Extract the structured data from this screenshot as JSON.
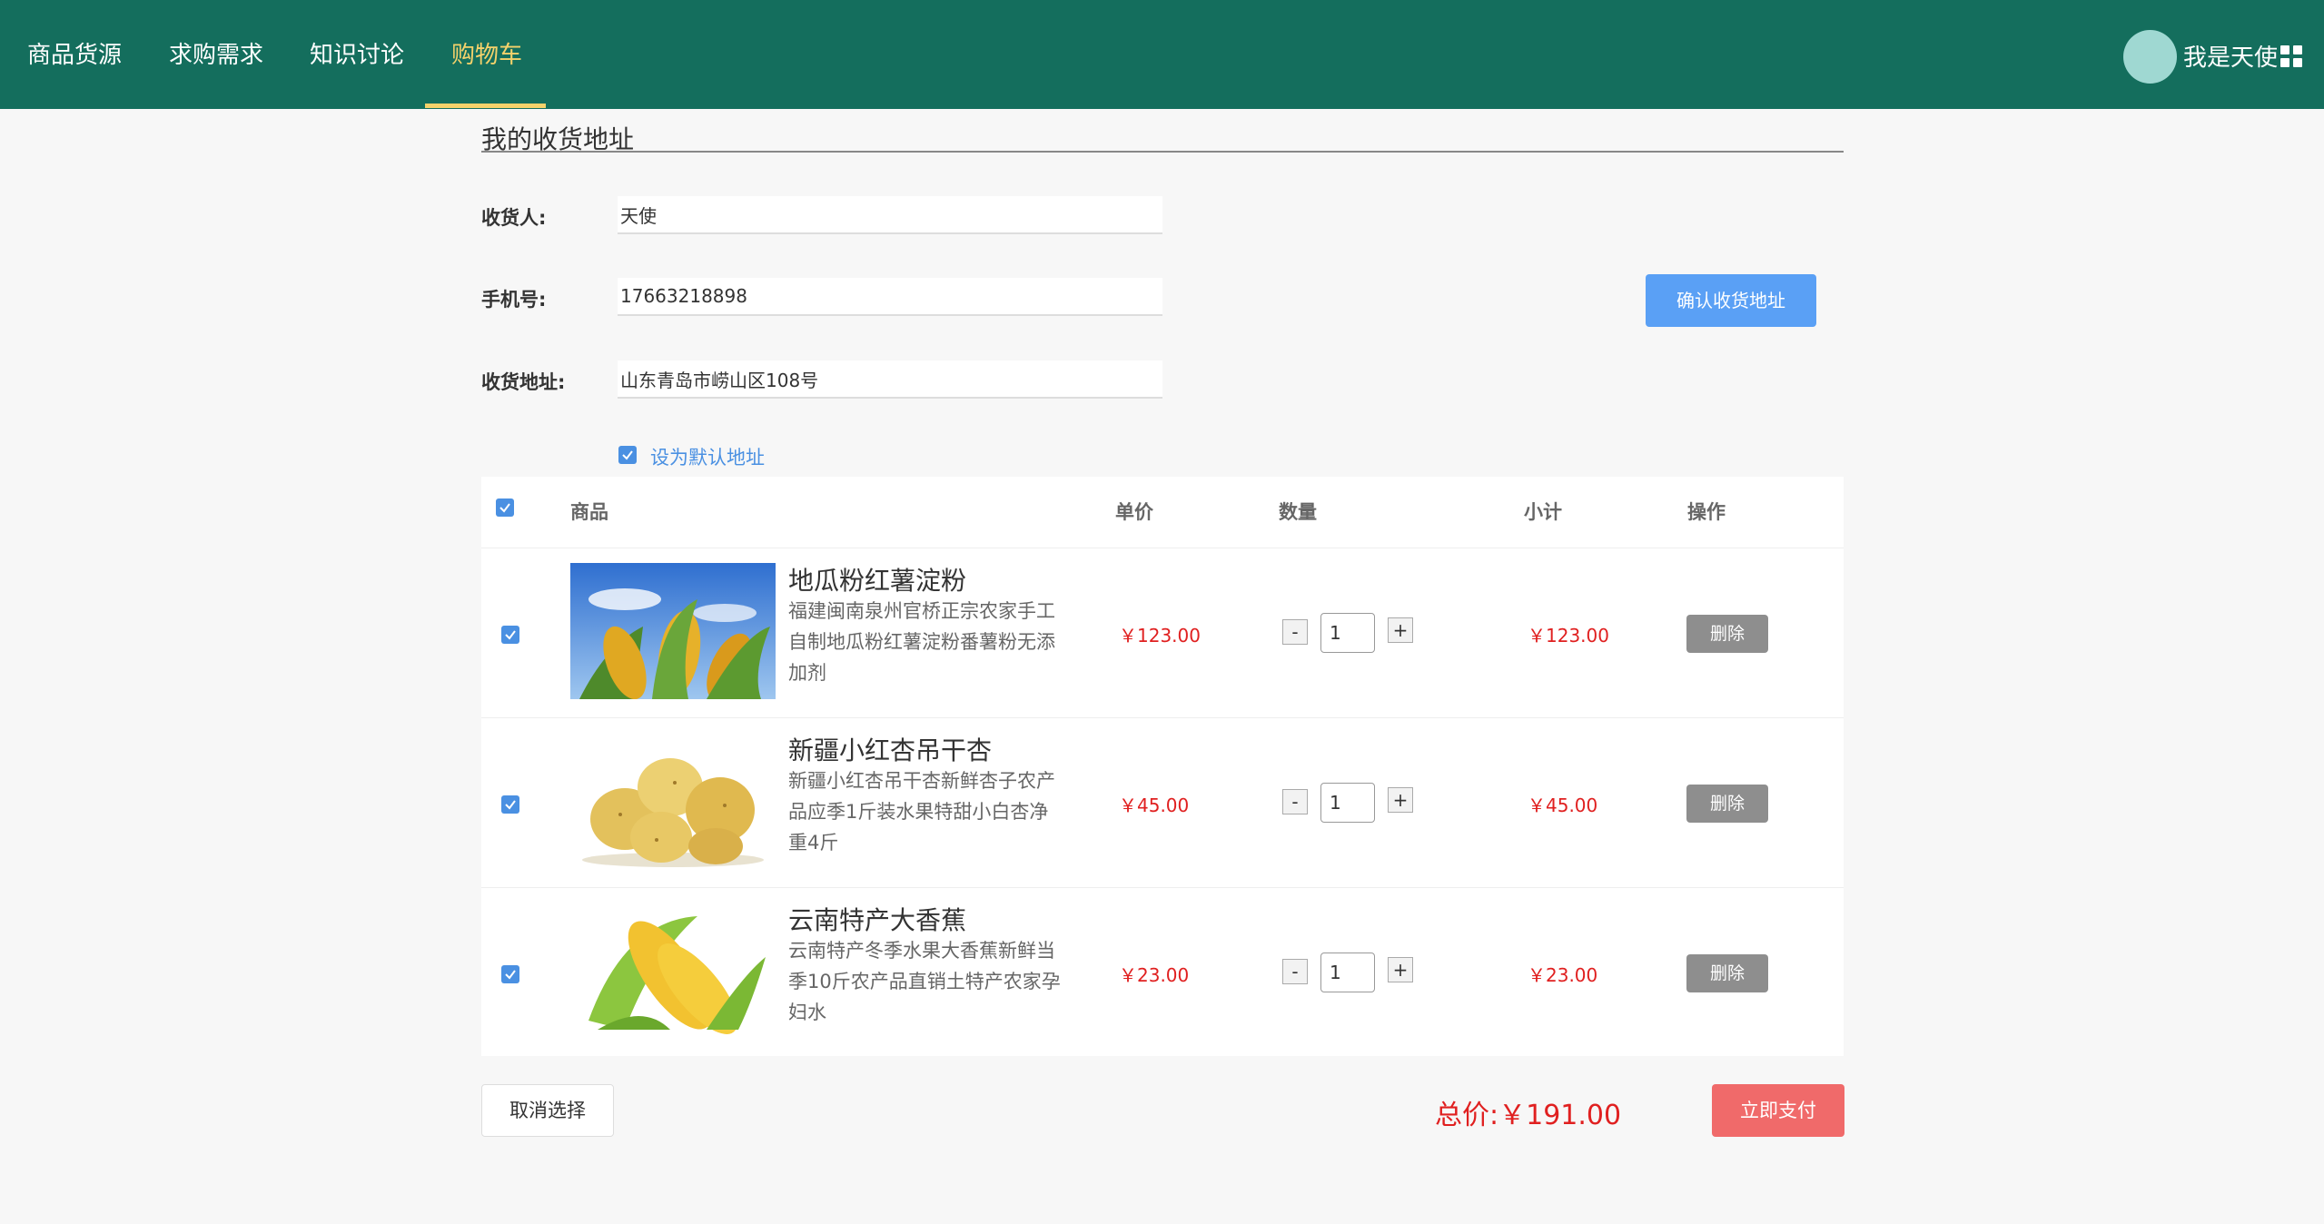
{
  "nav": {
    "items": [
      {
        "label": "商品货源",
        "active": false
      },
      {
        "label": "求购需求",
        "active": false
      },
      {
        "label": "知识讨论",
        "active": false
      },
      {
        "label": "购物车",
        "active": true
      }
    ],
    "username": "我是天使",
    "avatar_icon": "avatar",
    "menu_icon": "grid-icon",
    "colors": {
      "background": "#146e5d",
      "active": "#f5d26b"
    }
  },
  "address": {
    "title": "我的收货地址",
    "receiver_label": "收货人:",
    "receiver_value": "天使",
    "phone_label": "手机号:",
    "phone_value": "17663218898",
    "address_label": "收货地址:",
    "address_value": "山东青岛市崂山区108号",
    "default_label": "设为默认地址",
    "default_checked": true,
    "confirm_label": "确认收货地址"
  },
  "cart": {
    "headers": {
      "product": "商品",
      "unit_price": "单价",
      "quantity": "数量",
      "subtotal": "小计",
      "action": "操作"
    },
    "select_all_checked": true,
    "items": [
      {
        "title": "地瓜粉红薯淀粉",
        "desc": "福建闽南泉州官桥正宗农家手工自制地瓜粉红薯淀粉番薯粉无添加剂",
        "price": "￥123.00",
        "qty": "1",
        "subtotal": "￥123.00",
        "delete_label": "删除",
        "checked": true
      },
      {
        "title": "新疆小红杏吊干杏",
        "desc": "新疆小红杏吊干杏新鲜杏子农产品应季1斤装水果特甜小白杏净重4斤",
        "price": "￥45.00",
        "qty": "1",
        "subtotal": "￥45.00",
        "delete_label": "删除",
        "checked": true
      },
      {
        "title": "云南特产大香蕉",
        "desc": "云南特产冬季水果大香蕉新鲜当季10斤农产品直销土特产农家孕妇水",
        "price": "￥23.00",
        "qty": "1",
        "subtotal": "￥23.00",
        "delete_label": "删除",
        "checked": true
      }
    ],
    "qty_minus": "-",
    "qty_plus": "+"
  },
  "footer": {
    "cancel_label": "取消选择",
    "total_label": "总价:",
    "total_value": "￥191.00",
    "pay_label": "立即支付"
  }
}
